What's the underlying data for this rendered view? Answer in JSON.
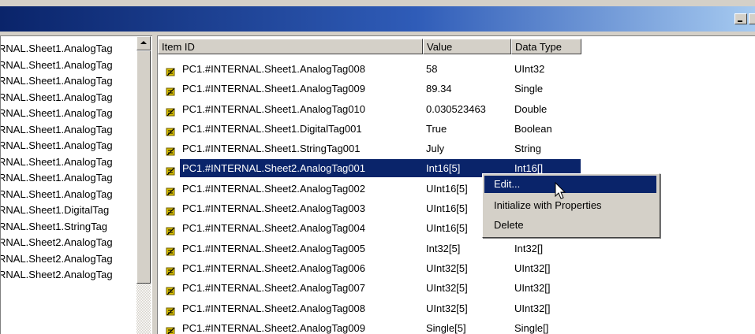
{
  "window": {
    "title": ""
  },
  "tree": {
    "items": [
      "RNAL.Sheet1.AnalogTag",
      "RNAL.Sheet1.AnalogTag",
      "RNAL.Sheet1.AnalogTag",
      "RNAL.Sheet1.AnalogTag",
      "RNAL.Sheet1.AnalogTag",
      "RNAL.Sheet1.AnalogTag",
      "RNAL.Sheet1.AnalogTag",
      "RNAL.Sheet1.AnalogTag",
      "RNAL.Sheet1.AnalogTag",
      "RNAL.Sheet1.AnalogTag",
      "RNAL.Sheet1.DigitalTag",
      "RNAL.Sheet1.StringTag",
      "RNAL.Sheet2.AnalogTag",
      "RNAL.Sheet2.AnalogTag",
      "RNAL.Sheet2.AnalogTag"
    ]
  },
  "table": {
    "columns": [
      "Item ID",
      "Value",
      "Data Type"
    ],
    "rows": [
      {
        "id": "PC1.#INTERNAL.Sheet1.AnalogTag008",
        "value": "58",
        "type": "UInt32"
      },
      {
        "id": "PC1.#INTERNAL.Sheet1.AnalogTag009",
        "value": "89.34",
        "type": "Single"
      },
      {
        "id": "PC1.#INTERNAL.Sheet1.AnalogTag010",
        "value": "0.030523463",
        "type": "Double"
      },
      {
        "id": "PC1.#INTERNAL.Sheet1.DigitalTag001",
        "value": "True",
        "type": "Boolean"
      },
      {
        "id": "PC1.#INTERNAL.Sheet1.StringTag001",
        "value": "July",
        "type": "String"
      },
      {
        "id": "PC1.#INTERNAL.Sheet2.AnalogTag001",
        "value": "Int16[5]",
        "type": "Int16[]"
      },
      {
        "id": "PC1.#INTERNAL.Sheet2.AnalogTag002",
        "value": "UInt16[5]",
        "type": ""
      },
      {
        "id": "PC1.#INTERNAL.Sheet2.AnalogTag003",
        "value": "UInt16[5]",
        "type": ""
      },
      {
        "id": "PC1.#INTERNAL.Sheet2.AnalogTag004",
        "value": "UInt16[5]",
        "type": ""
      },
      {
        "id": "PC1.#INTERNAL.Sheet2.AnalogTag005",
        "value": "Int32[5]",
        "type": "Int32[]"
      },
      {
        "id": "PC1.#INTERNAL.Sheet2.AnalogTag006",
        "value": "UInt32[5]",
        "type": "UInt32[]"
      },
      {
        "id": "PC1.#INTERNAL.Sheet2.AnalogTag007",
        "value": "UInt32[5]",
        "type": "UInt32[]"
      },
      {
        "id": "PC1.#INTERNAL.Sheet2.AnalogTag008",
        "value": "UInt32[5]",
        "type": "UInt32[]"
      },
      {
        "id": "PC1.#INTERNAL.Sheet2.AnalogTag009",
        "value": "Single[5]",
        "type": "Single[]"
      }
    ]
  },
  "context_menu": {
    "items": [
      "Edit...",
      "Initialize with Properties",
      "Delete"
    ]
  },
  "colors": {
    "selection": "#0a246a",
    "face": "#d4d0c8",
    "tag_icon": "#d8c000"
  },
  "icons": {
    "tag": "tag-icon",
    "minimize": "minimize-icon",
    "scroll_up": "scroll-up-icon"
  }
}
